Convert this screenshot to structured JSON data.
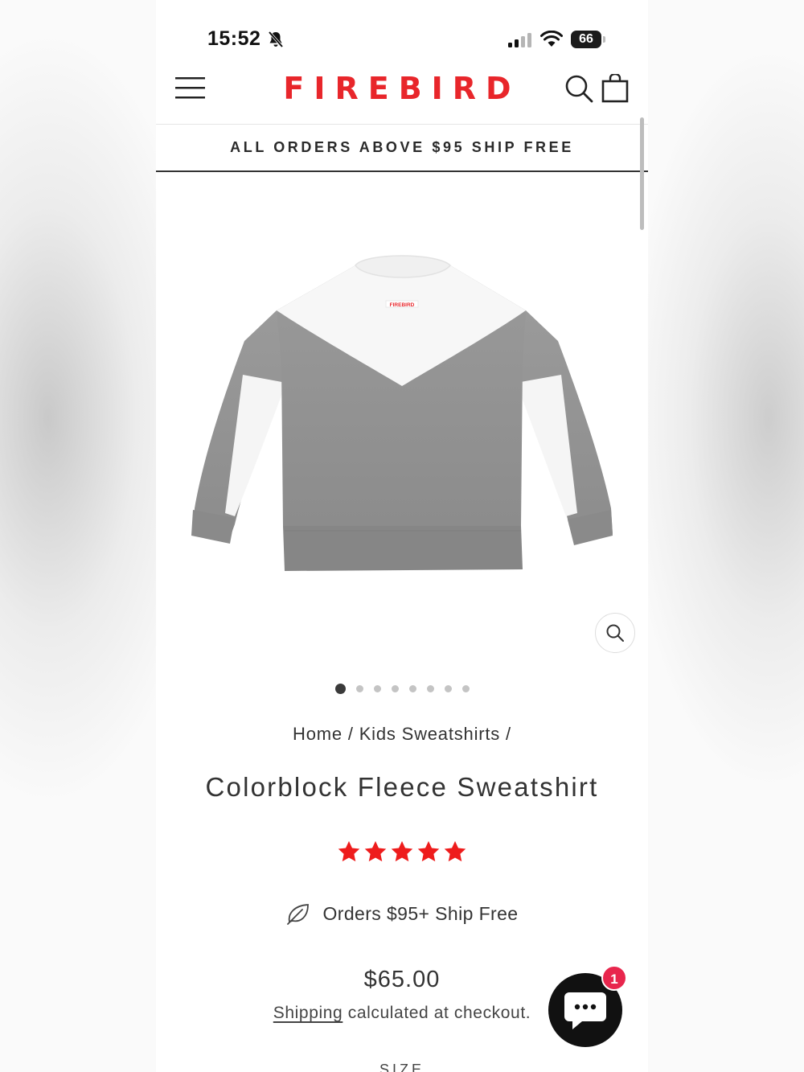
{
  "status_bar": {
    "time": "15:52",
    "battery": "66"
  },
  "header": {
    "logo": "FIREBIRD"
  },
  "announcement": "ALL ORDERS ABOVE $95 SHIP FREE",
  "gallery": {
    "image_count": 8,
    "active_index": 0,
    "garment_label": "FIREBIRD"
  },
  "breadcrumb": {
    "home": "Home",
    "separator": " / ",
    "category": "Kids Sweatshirts",
    "trailing": " /"
  },
  "product": {
    "title": "Colorblock Fleece Sweatshirt",
    "rating": 5,
    "ship_note": "Orders $95+ Ship Free",
    "price": "$65.00",
    "shipping_link": "Shipping",
    "shipping_rest": " calculated at checkout.",
    "size_label": "SIZE"
  },
  "chat": {
    "badge": "1"
  },
  "colors": {
    "brand_red": "#e8262b",
    "star_red": "#ee1c1c",
    "badge": "#e8264d"
  }
}
